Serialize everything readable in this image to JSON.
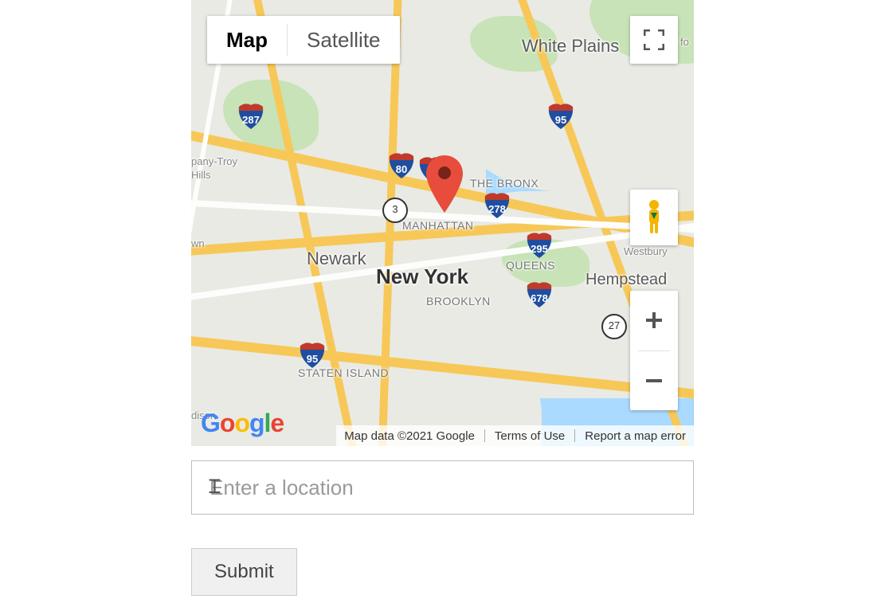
{
  "map": {
    "type_tabs": {
      "map": "Map",
      "satellite": "Satellite"
    },
    "big_label": "New York",
    "labels": {
      "white_plains": "White Plains",
      "bronx": "THE BRONX",
      "manhattan": "MANHATTAN",
      "newark": "Newark",
      "queens": "QUEENS",
      "brooklyn": "BROOKLYN",
      "hempstead": "Hempstead",
      "westbury": "Westbury",
      "staten_island": "STATEN ISLAND",
      "pany_troy": "pany-Troy",
      "hills": "Hills",
      "wn": "wn",
      "dison": "dison",
      "fo": "fo"
    },
    "interstates": {
      "i287": "287",
      "i80": "80",
      "i95a": "95",
      "i95b": "95",
      "i95c": "95",
      "i278": "278",
      "i295": "295",
      "i678": "678"
    },
    "routes": {
      "r3": "3",
      "r27": "27"
    },
    "footer": {
      "copyright": "Map data ©2021 Google",
      "terms": "Terms of Use",
      "report": "Report a map error"
    }
  },
  "form": {
    "placeholder": "Enter a location",
    "submit": "Submit"
  }
}
